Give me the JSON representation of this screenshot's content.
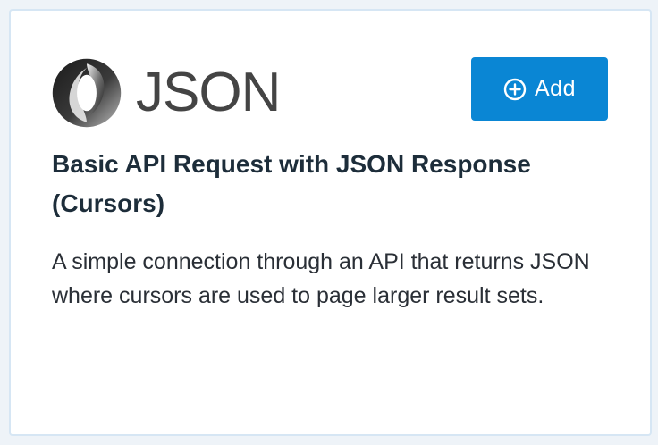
{
  "card": {
    "logo": {
      "icon": "json-logo-icon",
      "text": "JSON"
    },
    "add_button": {
      "icon": "plus-circle-icon",
      "label": "Add"
    },
    "title": "Basic API Request with JSON Response (Cursors)",
    "description": "A simple connection through an API that returns JSON where cursors are used to page larger result sets."
  },
  "colors": {
    "button_background": "#0a86d4",
    "card_border": "#d6e6f4",
    "title_text": "#1d2d3a"
  }
}
